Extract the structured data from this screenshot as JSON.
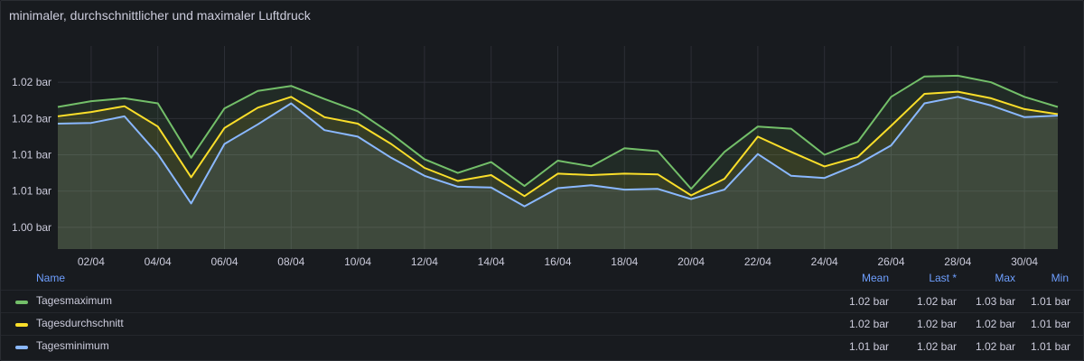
{
  "panel": {
    "title": "minimaler, durchschnittlicher und maximaler Luftdruck"
  },
  "legend": {
    "name_header": "Name",
    "mean_header": "Mean",
    "last_header": "Last *",
    "max_header": "Max",
    "min_header": "Min",
    "rows": [
      {
        "name": "Tagesmaximum",
        "color": "#73bf69",
        "mean": "1.02 bar",
        "last": "1.02 bar",
        "max": "1.03 bar",
        "min": "1.01 bar"
      },
      {
        "name": "Tagesdurchschnitt",
        "color": "#fade2a",
        "mean": "1.02 bar",
        "last": "1.02 bar",
        "max": "1.02 bar",
        "min": "1.01 bar"
      },
      {
        "name": "Tagesminimum",
        "color": "#8ab8ff",
        "mean": "1.01 bar",
        "last": "1.02 bar",
        "max": "1.02 bar",
        "min": "1.01 bar"
      }
    ]
  },
  "chart_data": {
    "type": "line",
    "title": "minimaler, durchschnittlicher und maximaler Luftdruck",
    "x": [
      "01/04",
      "02/04",
      "03/04",
      "04/04",
      "05/04",
      "06/04",
      "07/04",
      "08/04",
      "09/04",
      "10/04",
      "11/04",
      "12/04",
      "13/04",
      "14/04",
      "15/04",
      "16/04",
      "17/04",
      "18/04",
      "19/04",
      "20/04",
      "21/04",
      "22/04",
      "23/04",
      "24/04",
      "25/04",
      "26/04",
      "27/04",
      "28/04",
      "29/04",
      "30/04",
      "01/05"
    ],
    "x_tick_labels": [
      "02/04",
      "04/04",
      "06/04",
      "08/04",
      "10/04",
      "12/04",
      "14/04",
      "16/04",
      "18/04",
      "20/04",
      "22/04",
      "24/04",
      "26/04",
      "28/04",
      "30/04"
    ],
    "y_tick_values": [
      1.0025,
      1.0075,
      1.0125,
      1.0175,
      1.0225
    ],
    "y_tick_labels": [
      "1.00 bar",
      "1.01 bar",
      "1.01 bar",
      "1.02 bar",
      "1.02 bar"
    ],
    "ylim": [
      0.9995,
      1.0275
    ],
    "grid": true,
    "legend_position": "bottom",
    "series": [
      {
        "name": "Tagesmaximum",
        "color": "#73bf69",
        "values": [
          1.0191,
          1.0199,
          1.0203,
          1.0196,
          1.0121,
          1.0189,
          1.0213,
          1.022,
          1.0202,
          1.0185,
          1.0154,
          1.0119,
          1.01,
          1.0115,
          1.0082,
          1.0117,
          1.0109,
          1.0134,
          1.013,
          1.0078,
          1.0129,
          1.0164,
          1.0161,
          1.0125,
          1.0143,
          1.0205,
          1.0233,
          1.0234,
          1.0225,
          1.0205,
          1.0191
        ]
      },
      {
        "name": "Tagesdurchschnitt",
        "color": "#fade2a",
        "values": [
          1.0178,
          1.0184,
          1.0192,
          1.0164,
          1.0094,
          1.0162,
          1.019,
          1.0205,
          1.0177,
          1.0168,
          1.014,
          1.0107,
          1.0089,
          1.0097,
          1.0068,
          1.0099,
          1.0097,
          1.0099,
          1.0098,
          1.0069,
          1.0092,
          1.015,
          1.0129,
          1.0109,
          1.0122,
          1.0165,
          1.0209,
          1.0212,
          1.0203,
          1.0188,
          1.0181
        ]
      },
      {
        "name": "Tagesminimum",
        "color": "#8ab8ff",
        "values": [
          1.0168,
          1.0169,
          1.0178,
          1.0126,
          1.0058,
          1.014,
          1.0167,
          1.0196,
          1.0159,
          1.015,
          1.0121,
          1.0096,
          1.0081,
          1.008,
          1.0054,
          1.0079,
          1.0083,
          1.0077,
          1.0078,
          1.0064,
          1.0077,
          1.0126,
          1.0096,
          1.0093,
          1.0112,
          1.0138,
          1.0196,
          1.0205,
          1.0193,
          1.0177,
          1.0179
        ]
      }
    ]
  }
}
